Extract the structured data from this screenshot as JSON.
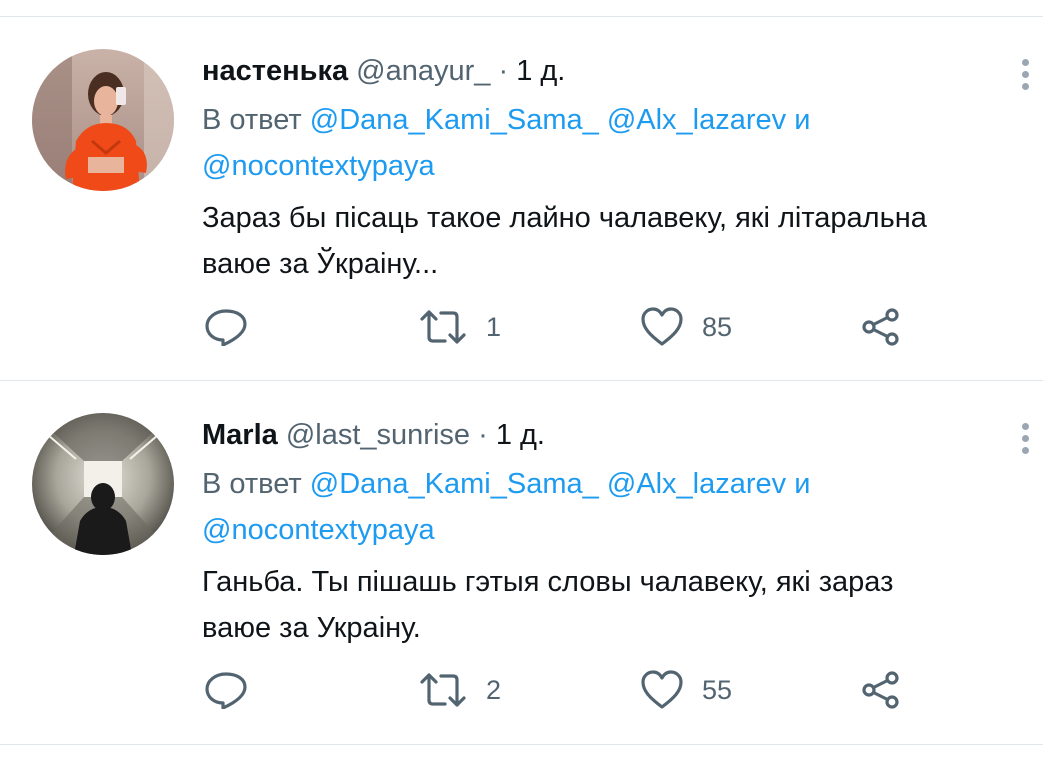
{
  "colors": {
    "link": "#1d9bf0",
    "secondary_text": "#536471",
    "primary_text": "#0f1419",
    "divider": "#e1e6ea"
  },
  "tweets": [
    {
      "display_name": "настенька",
      "handle": "@anayur_",
      "separator": "·",
      "time": "1 д.",
      "reply_prefix": "В ответ",
      "mentions": [
        "@Dana_Kami_Sama_",
        "@Alx_lazarev",
        "@nocontextypaya"
      ],
      "reply_conjunction": "и",
      "text_line1": "Зараз бы пісаць такое лайно чалавеку, які літаральна",
      "text_line2": "ваюе за Ўкраіну...",
      "reply_icon": "reply-icon",
      "retweet_count": "1",
      "like_count": "85",
      "share_icon": "share-icon"
    },
    {
      "display_name": "Marla",
      "handle": "@last_sunrise",
      "separator": "·",
      "time": "1 д.",
      "reply_prefix": "В ответ",
      "mentions": [
        "@Dana_Kami_Sama_",
        "@Alx_lazarev",
        "@nocontextypaya"
      ],
      "reply_conjunction": "и",
      "text_line1": "Ганьба. Ты пішашь гэтыя словы чалавеку, які зараз",
      "text_line2": "ваюе за Украіну.",
      "reply_icon": "reply-icon",
      "retweet_count": "2",
      "like_count": "55",
      "share_icon": "share-icon"
    }
  ]
}
